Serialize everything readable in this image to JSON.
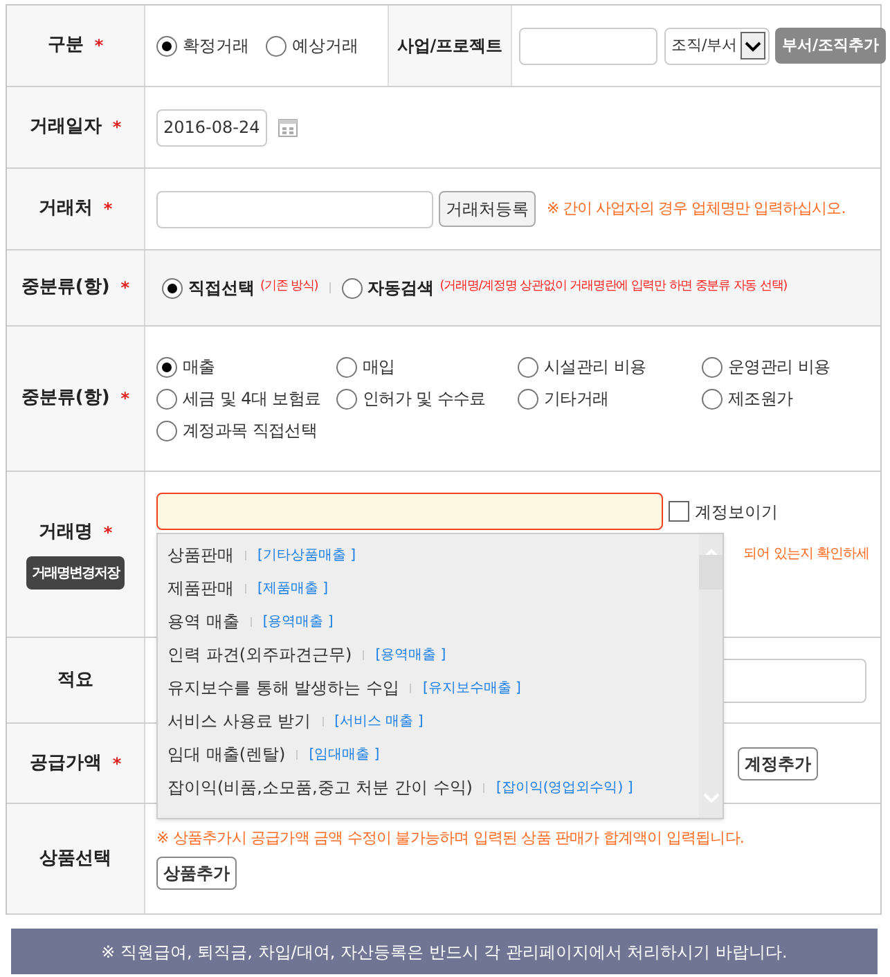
{
  "type_row": {
    "label": "구분",
    "mark": "*",
    "options": [
      {
        "label": "확정거래",
        "selected": true
      },
      {
        "label": "예상거래",
        "selected": false
      }
    ],
    "project_label": "사업/프로젝트",
    "org_select": "조직/부서",
    "add_org_button": "부서/조직추가"
  },
  "date_row": {
    "label": "거래일자",
    "mark": "*",
    "value": "2016-08-24"
  },
  "partner_row": {
    "label": "거래처",
    "mark": "*",
    "button": "거래처등록",
    "note": "※ 간이 사업자의 경우 업체명만 입력하십시오."
  },
  "mode_row": {
    "label": "중분류(항)",
    "mark": "*",
    "options": [
      {
        "label": "직접선택",
        "hint": "(기존 방식)",
        "selected": true
      },
      {
        "label": "자동검색",
        "hint": "(거래명/계정명 상관없이 거래명란에 입력만 하면 중분류 자동 선택)",
        "selected": false
      }
    ]
  },
  "category_row": {
    "label": "중분류(항)",
    "mark": "*",
    "options": [
      {
        "label": "매출",
        "selected": true
      },
      {
        "label": "매입",
        "selected": false
      },
      {
        "label": "시설관리 비용",
        "selected": false
      },
      {
        "label": "운영관리 비용",
        "selected": false
      },
      {
        "label": "세금 및 4대 보험료",
        "selected": false
      },
      {
        "label": "인허가 및 수수료",
        "selected": false
      },
      {
        "label": "기타거래",
        "selected": false
      },
      {
        "label": "제조원가",
        "selected": false
      },
      {
        "label": "계정과목 직접선택",
        "selected": false
      }
    ]
  },
  "name_row": {
    "label": "거래명",
    "mark": "*",
    "save_button": "거래명변경저장",
    "show_account": {
      "label": "계정보이기",
      "checked": false
    },
    "note": "되어 있는지 확인하세",
    "suggestions": [
      {
        "name": "상품판매",
        "account": "[기타상품매출 ]"
      },
      {
        "name": "제품판매",
        "account": "[제품매출 ]"
      },
      {
        "name": "용역 매출",
        "account": "[용역매출 ]"
      },
      {
        "name": "인력 파견(외주파견근무)",
        "account": "[용역매출 ]"
      },
      {
        "name": "유지보수를 통해 발생하는 수입",
        "account": "[유지보수매출 ]"
      },
      {
        "name": "서비스 사용료 받기",
        "account": "[서비스 매출 ]"
      },
      {
        "name": "임대 매출(렌탈)",
        "account": "[임대매출 ]"
      },
      {
        "name": "잡이익(비품,소모품,중고 처분 간이 수익)",
        "account": "[잡이익(영업외수익) ]"
      }
    ]
  },
  "memo_row": {
    "label": "적요"
  },
  "amount_row": {
    "label": "공급가액",
    "mark": "*",
    "button": "계정추가"
  },
  "product_row": {
    "label": "상품선택",
    "note": "※ 상품추가시 공급가액 금액 수정이 불가능하며 입력된 상품 판매가 합계액이 입력됩니다.",
    "button": "상품추가"
  },
  "footer": "※ 직원급여, 퇴직금, 차입/대여, 자산등록은 반드시 각 관리페이지에서 처리하시기 바랍니다."
}
